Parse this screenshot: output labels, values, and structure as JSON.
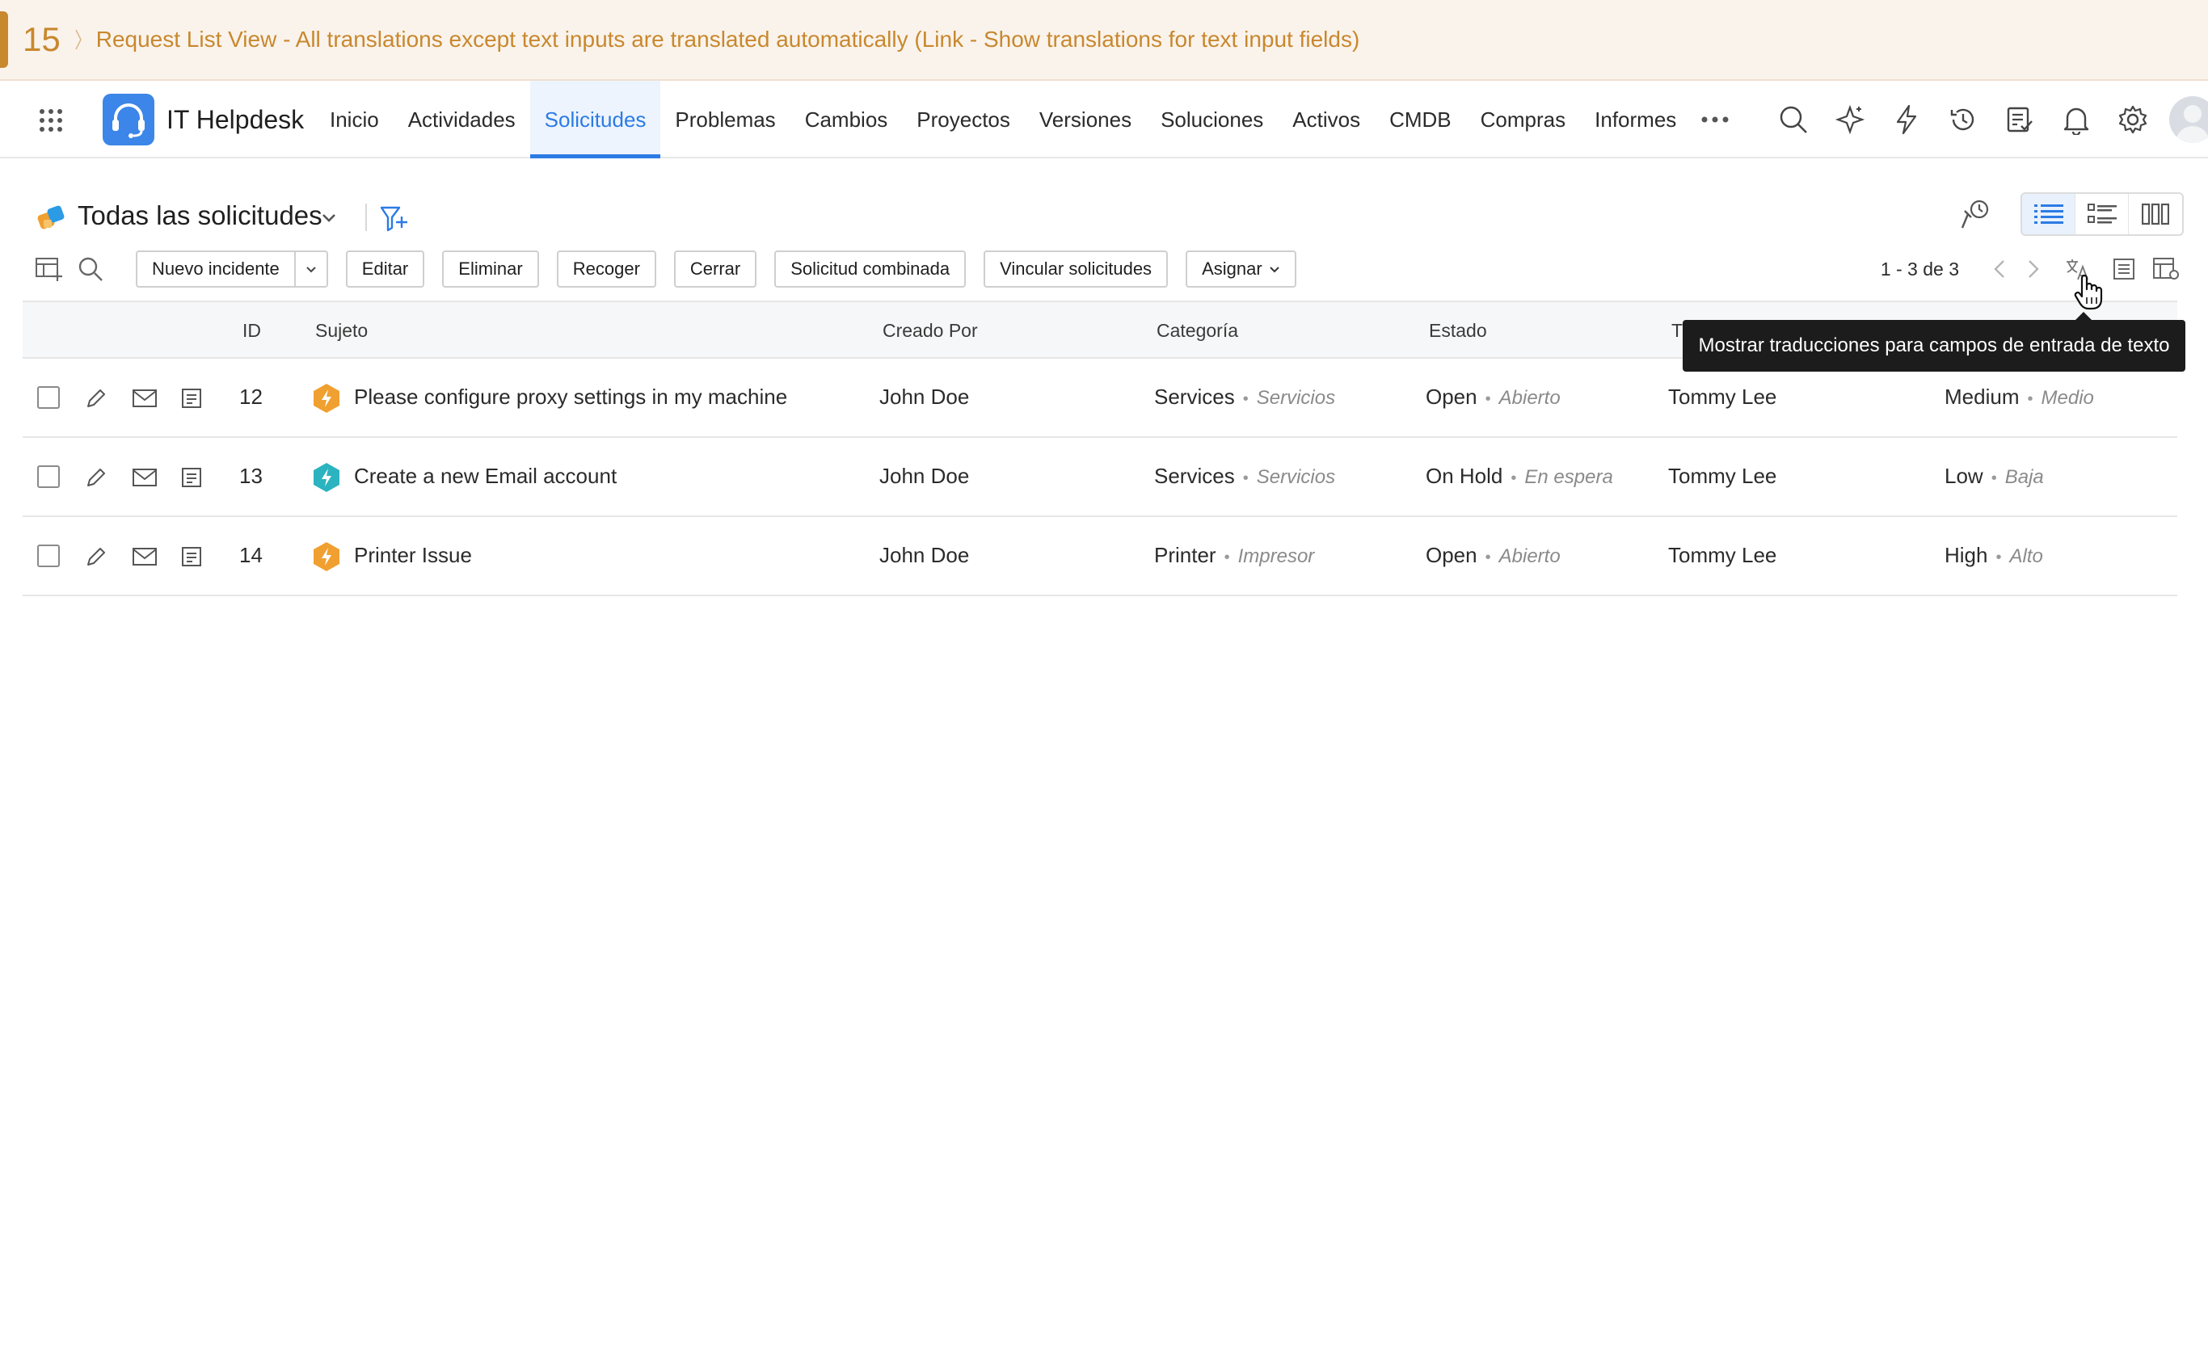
{
  "banner": {
    "step": "15",
    "title": "Request List View - All translations except text inputs are translated automatically (Link - Show translations for text input fields)"
  },
  "app": {
    "name": "IT Helpdesk"
  },
  "nav": {
    "items": [
      "Inicio",
      "Actividades",
      "Solicitudes",
      "Problemas",
      "Cambios",
      "Proyectos",
      "Versiones",
      "Soluciones",
      "Activos",
      "CMDB",
      "Compras",
      "Informes"
    ],
    "active": "Solicitudes"
  },
  "view": {
    "title": "Todas las solicitudes"
  },
  "toolbar": {
    "new_incident": "Nuevo incidente",
    "edit": "Editar",
    "delete": "Eliminar",
    "pickup": "Recoger",
    "close": "Cerrar",
    "merge": "Solicitud combinada",
    "link": "Vincular solicitudes",
    "assign": "Asignar"
  },
  "pager": {
    "text": "1 - 3 de 3"
  },
  "table": {
    "headers": {
      "id": "ID",
      "subject": "Sujeto",
      "created_by": "Creado Por",
      "category": "Categoría",
      "status": "Estado",
      "technician_partial": "T"
    },
    "rows": [
      {
        "id": "12",
        "subject": "Please configure proxy settings in my machine",
        "created_by": "John Doe",
        "category": "Services",
        "category_tr": "Servicios",
        "status": "Open",
        "status_tr": "Abierto",
        "technician": "Tommy Lee",
        "priority": "Medium",
        "priority_tr": "Medio",
        "badge_color": "#f0a030"
      },
      {
        "id": "13",
        "subject": "Create a new Email account",
        "created_by": "John Doe",
        "category": "Services",
        "category_tr": "Servicios",
        "status": "On Hold",
        "status_tr": "En espera",
        "technician": "Tommy Lee",
        "priority": "Low",
        "priority_tr": "Baja",
        "badge_color": "#2bb3c0"
      },
      {
        "id": "14",
        "subject": "Printer Issue",
        "created_by": "John Doe",
        "category": "Printer",
        "category_tr": "Impresor",
        "status": "Open",
        "status_tr": "Abierto",
        "technician": "Tommy Lee",
        "priority": "High",
        "priority_tr": "Alto",
        "badge_color": "#f0a030"
      }
    ]
  },
  "tooltip": {
    "text": "Mostrar traducciones para campos de entrada de texto"
  },
  "colors": {
    "banner_accent": "#c8882e",
    "primary": "#2c7be5",
    "logo": "#3b86e8"
  }
}
